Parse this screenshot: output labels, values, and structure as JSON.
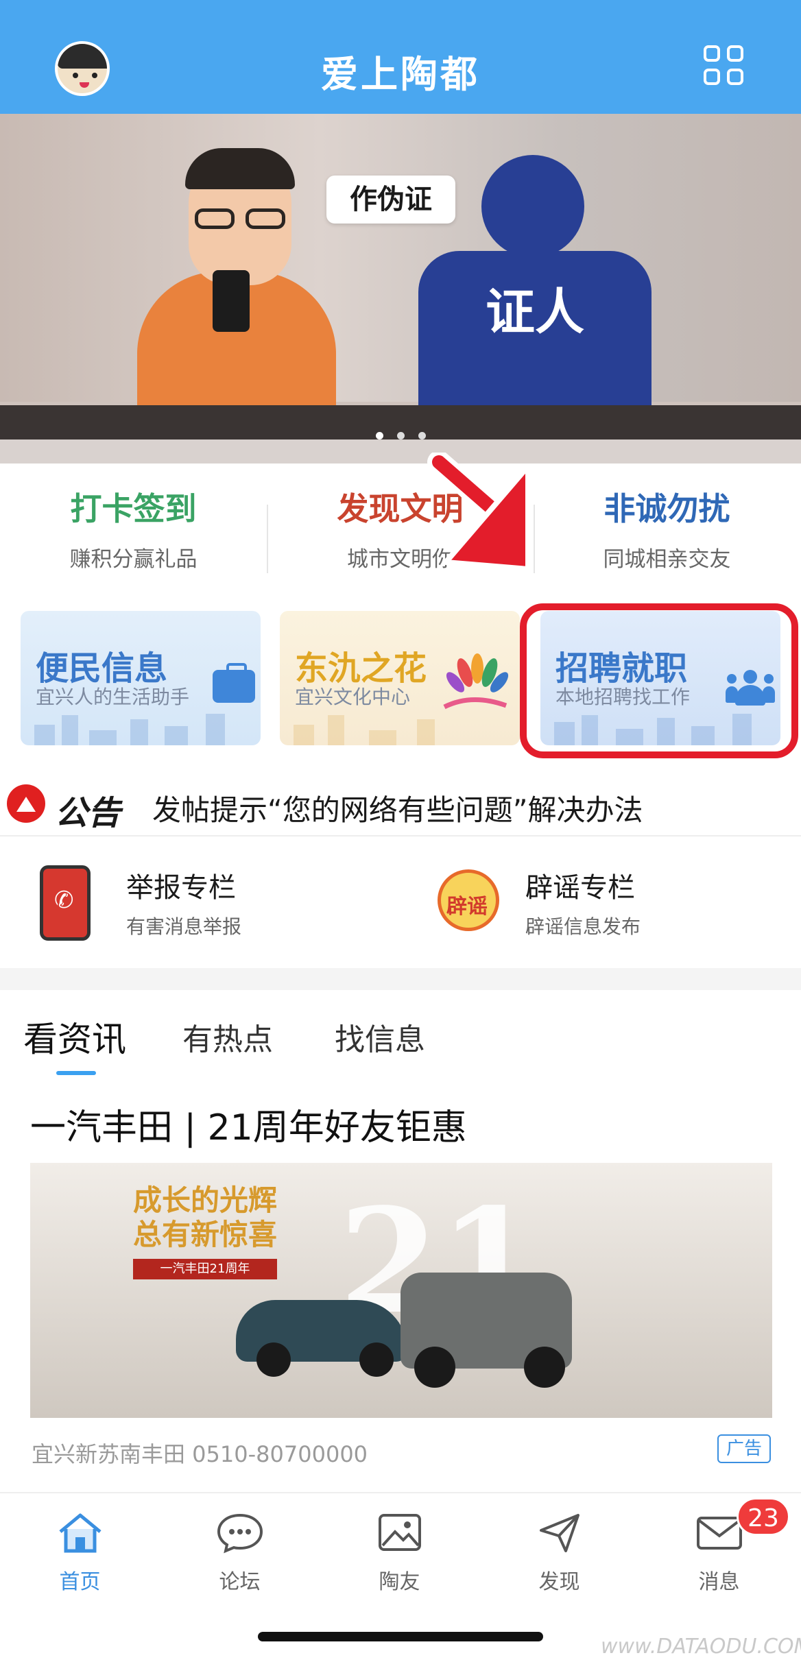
{
  "header": {
    "title": "爱上陶都"
  },
  "banner": {
    "bubble_text": "作伪证",
    "witness_label": "证人",
    "page_count": 3,
    "active_page": 1
  },
  "quick_links": [
    {
      "title": "打卡签到",
      "subtitle": "赚积分赢礼品",
      "color": "#3aa364"
    },
    {
      "title": "发现文明",
      "subtitle": "城市文明你",
      "color": "#c9432e"
    },
    {
      "title": "非诚勿扰",
      "subtitle": "同城相亲交友",
      "color": "#2f68b6"
    }
  ],
  "cards": [
    {
      "title": "便民信息",
      "subtitle": "宜兴人的生活助手",
      "icon": "briefcase-icon"
    },
    {
      "title": "东氿之花",
      "subtitle": "宜兴文化中心",
      "icon": "flower-icon"
    },
    {
      "title": "招聘就职",
      "subtitle": "本地招聘找工作",
      "icon": "people-icon"
    }
  ],
  "notice": {
    "tag": "公告",
    "text": "发帖提示“您的网络有些问题”解决办法"
  },
  "report": [
    {
      "title": "举报专栏",
      "subtitle": "有害消息举报",
      "icon": "phone-report-icon"
    },
    {
      "title": "辟谣专栏",
      "subtitle": "辟谣信息发布",
      "icon": "rumor-icon",
      "icon_text": "辟谣"
    }
  ],
  "tabs": [
    "看资讯",
    "有热点",
    "找信息"
  ],
  "active_tab": 0,
  "article": {
    "title": "一汽丰田 | 21周年好友钜惠",
    "image_slogan_1": "成长的光辉",
    "image_slogan_2": "总有新惊喜",
    "image_ribbon": "一汽丰田21周年",
    "image_big": "21",
    "source": "宜兴新苏南丰田 0510-80700000",
    "badge": "广告"
  },
  "bottom_nav": [
    {
      "label": "首页",
      "icon": "home-icon",
      "active": true
    },
    {
      "label": "论坛",
      "icon": "forum-icon",
      "active": false
    },
    {
      "label": "陶友",
      "icon": "image-icon",
      "active": false
    },
    {
      "label": "发现",
      "icon": "discover-icon",
      "active": false
    },
    {
      "label": "消息",
      "icon": "mail-icon",
      "active": false
    }
  ],
  "messages_badge": "23",
  "watermark": "www.DATAODU.COM",
  "colors": {
    "header": "#4aa7f0",
    "accent": "#3a8fe0",
    "highlight": "#e31d2b"
  }
}
